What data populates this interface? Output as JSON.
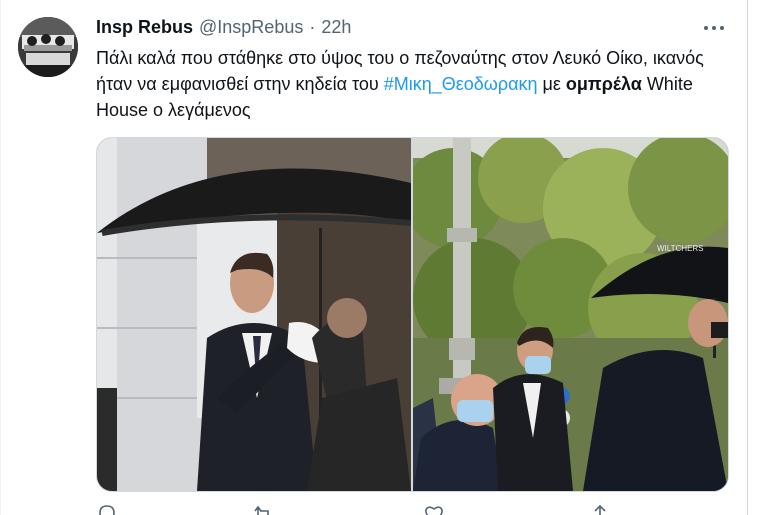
{
  "tweet": {
    "display_name": "Insp Rebus",
    "handle": "@InspRebus",
    "separator": "·",
    "time": "22h",
    "text_part1": "Πάλι καλά που στάθηκε στο ύψος του ο πεζοναύτης στον Λευκό Οίκο, ικανός ήταν να εμφανισθεί στην κηδεία του ",
    "hashtag": "#Μικη_Θεοδωρακη",
    "text_part2": "  με ",
    "bold_word": "ομπρέλα",
    "text_part3": " White House ο λεγάμενος"
  },
  "media": {
    "umbrella_brand_text": "WILTCHERS"
  },
  "icons": {
    "more": "more-horizontal-icon",
    "reply": "reply-icon",
    "retweet": "retweet-icon",
    "like": "heart-icon",
    "share": "share-icon"
  },
  "colors": {
    "link": "#1d9bf0",
    "secondary_text": "#536471",
    "primary_text": "#0f1419",
    "border": "#cfd9de"
  }
}
